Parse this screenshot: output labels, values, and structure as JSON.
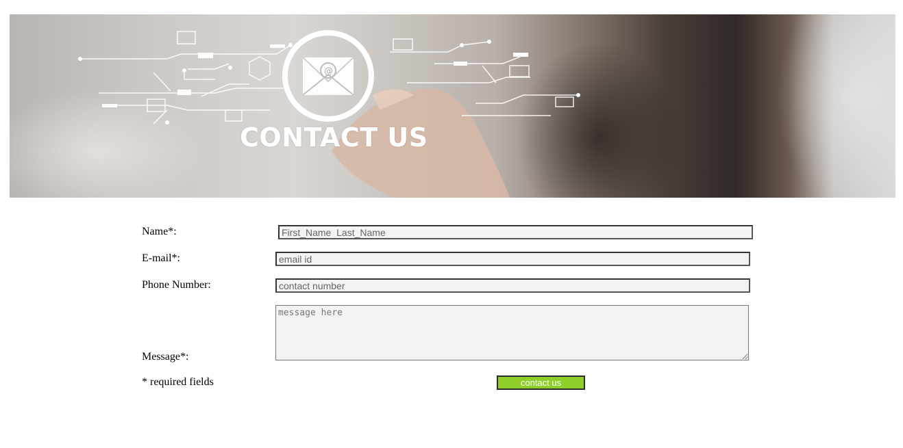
{
  "banner": {
    "title": "CONTACT US"
  },
  "form": {
    "name": {
      "label": "Name*:",
      "placeholder": "First_Name  Last_Name",
      "value": ""
    },
    "email": {
      "label": "E-mail*:",
      "placeholder": "email id",
      "value": ""
    },
    "phone": {
      "label": "Phone Number:",
      "placeholder": "contact number",
      "value": ""
    },
    "message": {
      "label": "Message*:",
      "placeholder": "message here",
      "value": ""
    },
    "required_note": "* required fields",
    "submit_label": "contact us"
  },
  "colors": {
    "submit_bg": "#8fcf2a",
    "field_bg": "#f3f3f3"
  }
}
